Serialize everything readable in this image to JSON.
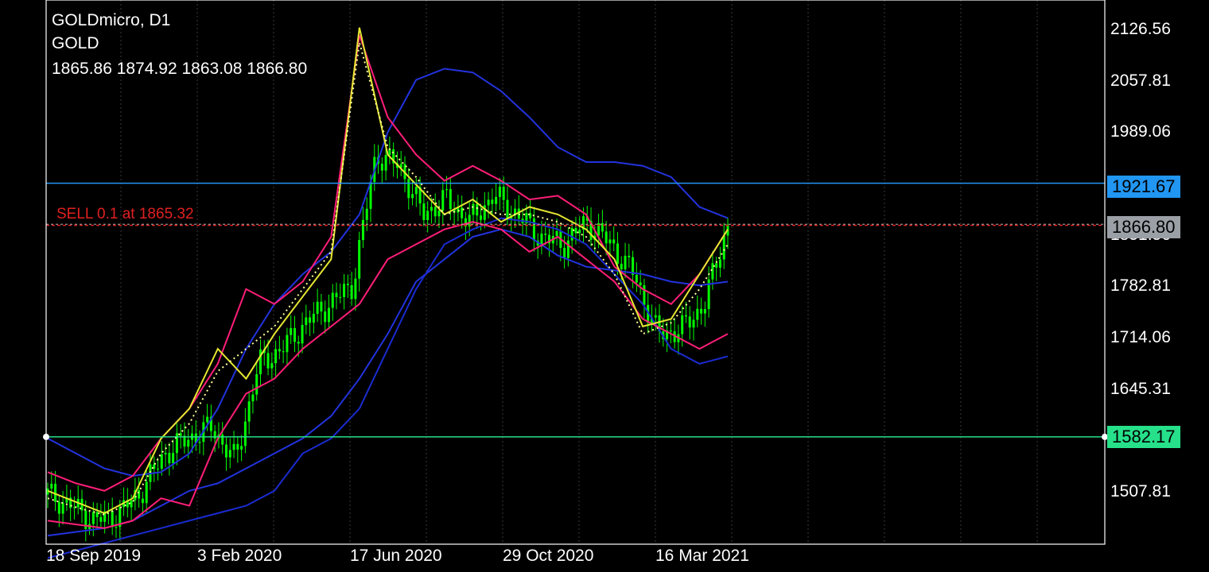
{
  "header": {
    "symbol_tf": "GOLDmicro, D1",
    "name": "GOLD",
    "ohlc": "1865.86 1874.92 1863.08 1866.80"
  },
  "order_line": {
    "label": "SELL 0.1 at 1865.32",
    "price": 1865.32,
    "color": "#e02020"
  },
  "tags": {
    "blue_level": {
      "text": "1921.67",
      "price": 1921.67,
      "color": "#2196f3"
    },
    "current": {
      "text": "1866.80",
      "price": 1866.8,
      "color": "#9aa0a6"
    },
    "green_level": {
      "text": "1582.17",
      "price": 1582.17,
      "color": "#26e08a"
    }
  },
  "chart_data": {
    "type": "line",
    "title": "GOLDmicro, D1",
    "x_labels": [
      "18 Sep 2019",
      "3 Feb 2020",
      "17 Jun 2020",
      "29 Oct 2020",
      "16 Mar 2021"
    ],
    "y_ticks": [
      "2126.56",
      "2057.81",
      "1989.06",
      "1851.56",
      "1782.81",
      "1714.06",
      "1645.31",
      "1507.81"
    ],
    "y_tick_values": [
      2126.56,
      2057.81,
      1989.06,
      1851.56,
      1782.81,
      1714.06,
      1645.31,
      1507.81
    ],
    "ylim": [
      1438.5,
      2167
    ],
    "x_index_range": [
      0,
      29
    ],
    "candle_color": "#00ff00",
    "price_series": {
      "name": "close",
      "x": [
        0,
        1,
        2,
        3,
        4,
        5,
        6,
        7,
        8,
        9,
        10,
        11,
        12,
        13,
        14,
        15,
        16,
        17,
        18,
        19,
        20,
        21,
        22,
        23,
        24,
        25,
        26,
        27,
        28,
        29
      ],
      "values": [
        1505,
        1490,
        1470,
        1478,
        1510,
        1560,
        1580,
        1595,
        1550,
        1680,
        1700,
        1735,
        1760,
        1785,
        1960,
        1945,
        1880,
        1900,
        1870,
        1905,
        1880,
        1850,
        1840,
        1870,
        1840,
        1800,
        1720,
        1725,
        1760,
        1866.8
      ]
    },
    "series": [
      {
        "name": "upper_band",
        "color": "#2233dd",
        "values": [
          1580,
          1560,
          1540,
          1530,
          1535,
          1560,
          1620,
          1700,
          1760,
          1800,
          1830,
          1880,
          1990,
          2060,
          2075,
          2070,
          2045,
          2010,
          1970,
          1950,
          1950,
          1945,
          1930,
          1890,
          1875
        ]
      },
      {
        "name": "lower_band",
        "color": "#2233dd",
        "values": [
          1450,
          1455,
          1460,
          1470,
          1490,
          1510,
          1520,
          1540,
          1560,
          1580,
          1610,
          1660,
          1720,
          1790,
          1820,
          1850,
          1860,
          1850,
          1825,
          1810,
          1805,
          1800,
          1790,
          1785,
          1790
        ]
      },
      {
        "name": "slow_ma",
        "color": "#1a2bd0",
        "values": [
          1420,
          1430,
          1440,
          1450,
          1460,
          1470,
          1480,
          1490,
          1510,
          1560,
          1580,
          1620,
          1700,
          1780,
          1840,
          1860,
          1875,
          1870,
          1860,
          1840,
          1800,
          1760,
          1700,
          1680,
          1690
        ]
      },
      {
        "name": "pink_upper",
        "color": "#ff1e78",
        "values": [
          1535,
          1520,
          1510,
          1530,
          1580,
          1620,
          1680,
          1780,
          1760,
          1790,
          1850,
          2120,
          2010,
          1960,
          1925,
          1945,
          1925,
          1900,
          1905,
          1880,
          1810,
          1780,
          1760,
          1800,
          1860
        ]
      },
      {
        "name": "pink_lower",
        "color": "#ff1e78",
        "values": [
          1470,
          1465,
          1460,
          1470,
          1500,
          1490,
          1580,
          1640,
          1660,
          1700,
          1730,
          1760,
          1820,
          1840,
          1860,
          1870,
          1860,
          1830,
          1850,
          1820,
          1790,
          1740,
          1720,
          1700,
          1720
        ]
      },
      {
        "name": "yellow_line",
        "color": "#e6e632",
        "values": [
          1510,
          1495,
          1480,
          1500,
          1580,
          1620,
          1700,
          1660,
          1720,
          1770,
          1820,
          2130,
          1960,
          1920,
          1880,
          1900,
          1870,
          1890,
          1880,
          1860,
          1820,
          1730,
          1740,
          1800,
          1860
        ]
      },
      {
        "name": "yellow_dotted",
        "color": "#ffff99",
        "values": [
          1500,
          1488,
          1478,
          1495,
          1560,
          1600,
          1670,
          1700,
          1730,
          1780,
          1830,
          2110,
          1970,
          1930,
          1880,
          1890,
          1880,
          1880,
          1870,
          1850,
          1800,
          1720,
          1735,
          1780,
          1840
        ]
      }
    ]
  }
}
